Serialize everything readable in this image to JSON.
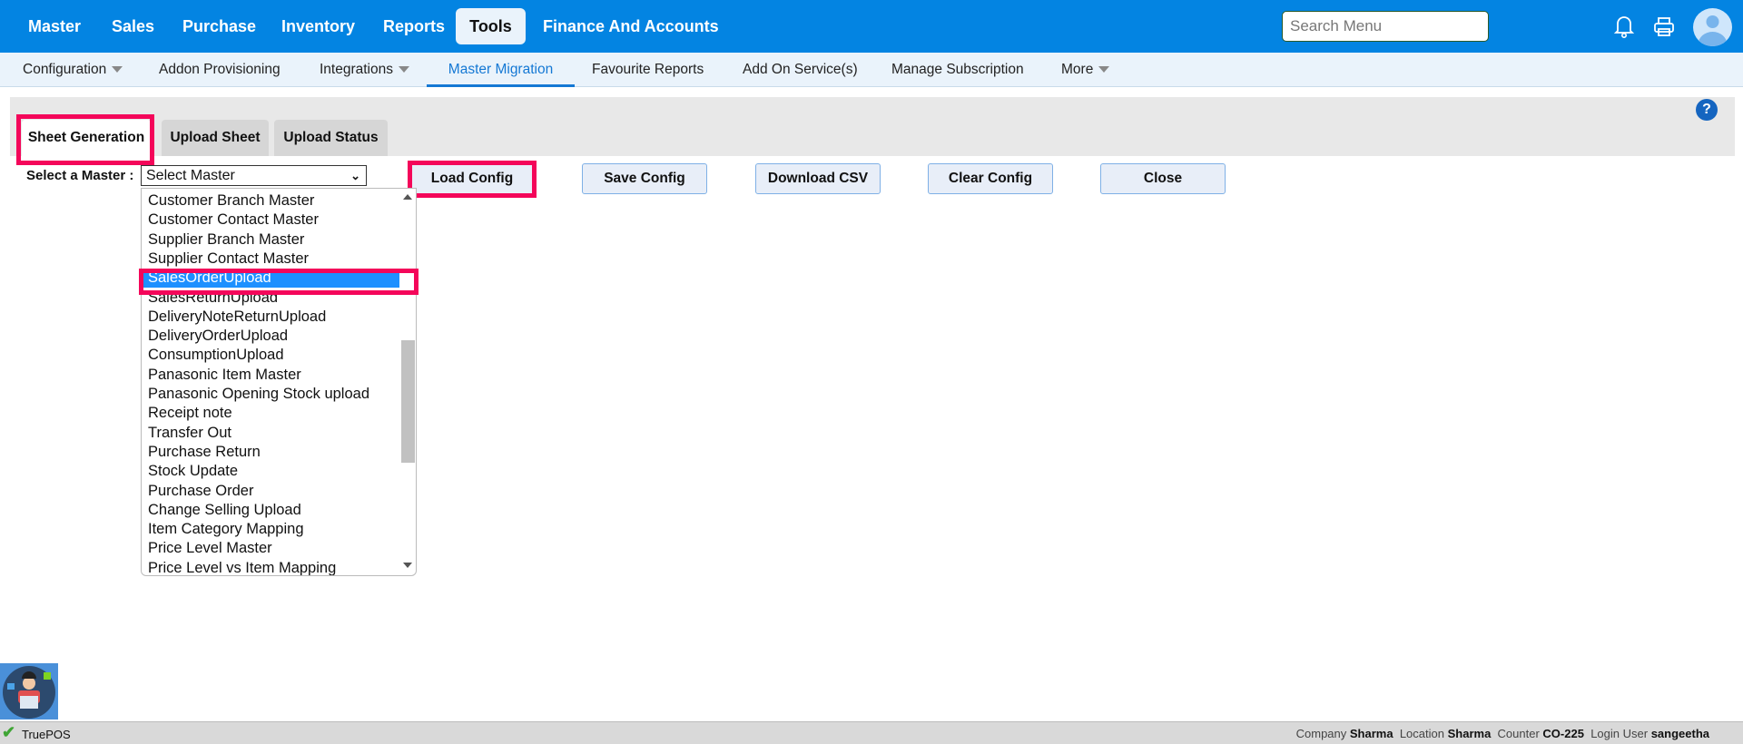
{
  "topnav": {
    "items": [
      "Master",
      "Sales",
      "Purchase",
      "Inventory",
      "Reports",
      "Tools",
      "Finance And Accounts"
    ],
    "active": "Tools",
    "search_placeholder": "Search Menu"
  },
  "subnav": {
    "items": [
      "Configuration",
      "Addon Provisioning",
      "Integrations",
      "Master Migration",
      "Favourite Reports",
      "Add On Service(s)",
      "Manage Subscription",
      "More"
    ],
    "active": "Master Migration"
  },
  "tabs": [
    "Sheet Generation",
    "Upload Sheet",
    "Upload Status"
  ],
  "form": {
    "label": "Select a Master :",
    "selected": "Select Master"
  },
  "buttons": [
    "Load Config",
    "Save Config",
    "Download CSV",
    "Clear Config",
    "Close"
  ],
  "options": [
    "Customer Branch Master",
    "Customer Contact Master",
    "Supplier Branch Master",
    "Supplier Contact Master",
    "SalesOrderUpload",
    "SalesReturnUpload",
    "DeliveryNoteReturnUpload",
    "DeliveryOrderUpload",
    "ConsumptionUpload",
    "Panasonic Item Master",
    "Panasonic Opening Stock upload",
    "Receipt note",
    "Transfer Out",
    "Purchase Return",
    "Stock Update",
    "Purchase Order",
    "Change Selling Upload",
    "Item Category Mapping",
    "Price Level Master",
    "Price Level vs Item Mapping"
  ],
  "highlighted_option": "SalesOrderUpload",
  "footer": {
    "app": "TruePOS",
    "company_label": "Company",
    "company": "Sharma",
    "location_label": "Location",
    "location": "Sharma",
    "counter_label": "Counter",
    "counter": "CO-225",
    "user_label": "Login User",
    "user": "sangeetha"
  },
  "colors": {
    "primary": "#0384e2",
    "highlight": "#f4065a",
    "selected": "#1e90ff"
  }
}
